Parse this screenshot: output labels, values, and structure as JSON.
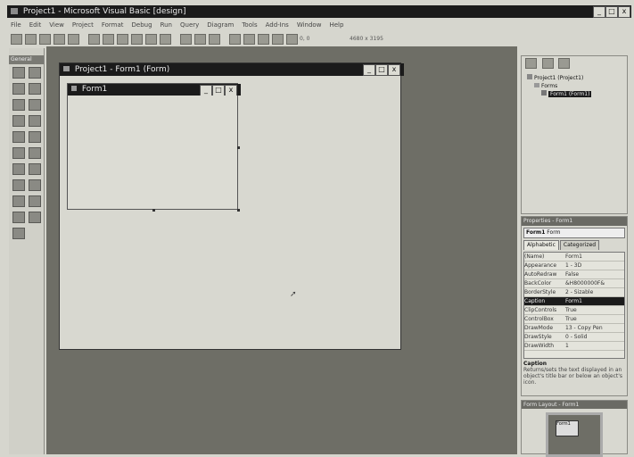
{
  "app": {
    "title": "Project1 - Microsoft Visual Basic [design]",
    "controls": {
      "minimize": "_",
      "maximize": "□",
      "close": "x"
    }
  },
  "menubar": {
    "items": [
      "File",
      "Edit",
      "View",
      "Project",
      "Format",
      "Debug",
      "Run",
      "Query",
      "Diagram",
      "Tools",
      "Add-Ins",
      "Window",
      "Help"
    ]
  },
  "toolbar": {
    "icons": [
      "add-project-icon",
      "add-form-icon",
      "menu-editor-icon",
      "open-icon",
      "save-icon",
      "cut-icon",
      "copy-icon",
      "paste-icon",
      "find-icon",
      "undo-icon",
      "redo-icon",
      "run-icon",
      "pause-icon",
      "stop-icon",
      "project-explorer-icon",
      "properties-icon",
      "form-layout-icon",
      "object-browser-icon",
      "toolbox-icon"
    ],
    "position_readout": "0, 0",
    "size_readout": "4680 x 3195"
  },
  "toolbox": {
    "title": "General"
  },
  "designer": {
    "title": "Project1 - Form1 (Form)",
    "form": {
      "caption": "Form1"
    }
  },
  "project_explorer": {
    "root": "Project1 (Project1)",
    "folder": "Forms",
    "item": "Form1 (Form1)"
  },
  "properties": {
    "title": "Properties - Form1",
    "object": "Form1",
    "object_type": "Form",
    "tabs": [
      "Alphabetic",
      "Categorized"
    ],
    "rows": [
      {
        "name": "(Name)",
        "value": "Form1"
      },
      {
        "name": "Appearance",
        "value": "1 - 3D"
      },
      {
        "name": "AutoRedraw",
        "value": "False"
      },
      {
        "name": "BackColor",
        "value": "&H8000000F&"
      },
      {
        "name": "BorderStyle",
        "value": "2 - Sizable"
      },
      {
        "name": "Caption",
        "value": "Form1"
      },
      {
        "name": "ClipControls",
        "value": "True"
      },
      {
        "name": "ControlBox",
        "value": "True"
      },
      {
        "name": "DrawMode",
        "value": "13 - Copy Pen"
      },
      {
        "name": "DrawStyle",
        "value": "0 - Solid"
      },
      {
        "name": "DrawWidth",
        "value": "1"
      }
    ],
    "desc_title": "Caption",
    "desc_text": "Returns/sets the text displayed in an object's title bar or below an object's icon."
  },
  "form_layout": {
    "title": "Form Layout - Form1",
    "preview_caption": "Form1"
  }
}
